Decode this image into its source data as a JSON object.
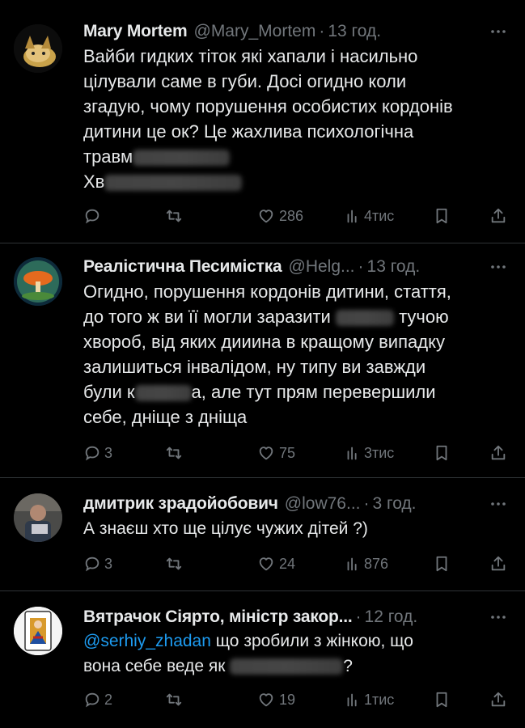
{
  "tweets": [
    {
      "name": "Mary Mortem",
      "handle": "@Mary_Mortem",
      "time": "13 год.",
      "lines": [
        "Вайби гидких тіток які хапали і насильно",
        "цілували саме в губи. Досі огидно коли",
        "згадую, чому порушення особистих кордонів",
        "дитини це ок? Це жахлива психологічна",
        "травм",
        "Хв"
      ],
      "reply_count": "",
      "like_count": "286",
      "view_count": "4тис"
    },
    {
      "name": "Реалістична Песимістка",
      "handle": "@Helg...",
      "time": "13 год.",
      "lines": [
        "Огидно, порушення кордонів дитини, стаття,",
        "до того ж ви її могли заразити",
        "тучою",
        "хвороб, від яких дииина в кращому випадку",
        "залишиться інвалідом, ну типу ви завжди",
        "були к",
        "а, але тут прям перевершили",
        "себе, дніще з дніща"
      ],
      "reply_count": "3",
      "like_count": "75",
      "view_count": "3тис"
    },
    {
      "name": "дмитрик зрадойобович",
      "handle": "@low76...",
      "time": "3 год.",
      "lines": [
        "А знаєш хто ще цілує чужих дітей ?)"
      ],
      "reply_count": "3",
      "like_count": "24",
      "view_count": "876"
    },
    {
      "name": "Вятрачок Сіярто, міністр закор...",
      "handle": "",
      "time": "12 год.",
      "mention": "@serhiy_zhadan",
      "lines": [
        "що зробили з жінкою, що",
        "вона себе веде як",
        "?"
      ],
      "reply_count": "2",
      "like_count": "19",
      "view_count": "1тис"
    }
  ],
  "dot": "·",
  "colors": {
    "background": "#000000",
    "text": "#e7e9ea",
    "secondary": "#71767b",
    "divider": "#2f3336",
    "link": "#1d9bf0"
  },
  "icons": [
    "reply-icon",
    "retweet-icon",
    "like-icon",
    "views-icon",
    "bookmark-icon",
    "share-icon",
    "more-icon"
  ]
}
